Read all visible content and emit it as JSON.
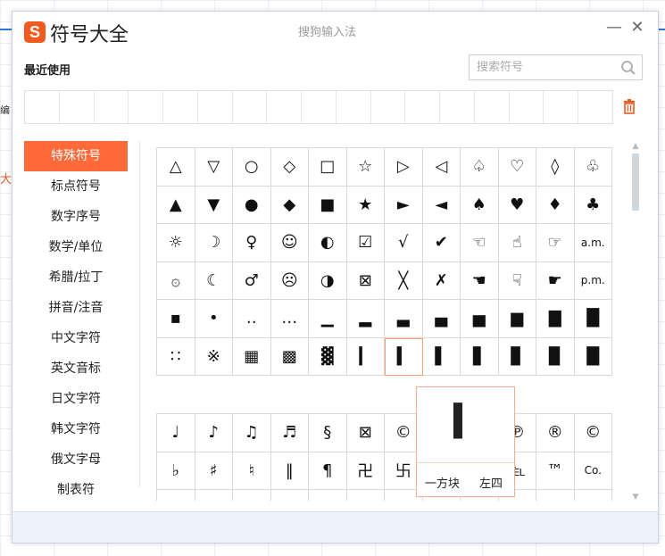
{
  "window": {
    "title": "符号大全",
    "subtitle": "搜狗输入法",
    "logo_letter": "S",
    "minimize_label": "—",
    "close_label": "✕"
  },
  "background": {
    "fragment_text": "编",
    "red_fragment": "大"
  },
  "recent": {
    "label": "最近使用",
    "cells": [
      "",
      "",
      "",
      "",
      "",
      "",
      "",
      "",
      "",
      "",
      "",
      "",
      "",
      "",
      "",
      "",
      ""
    ]
  },
  "search": {
    "placeholder": "搜索符号",
    "value": ""
  },
  "sidebar": {
    "items": [
      {
        "label": "特殊符号",
        "active": true
      },
      {
        "label": "标点符号"
      },
      {
        "label": "数字序号"
      },
      {
        "label": "数学/单位"
      },
      {
        "label": "希腊/拉丁"
      },
      {
        "label": "拼音/注音"
      },
      {
        "label": "中文字符"
      },
      {
        "label": "英文音标"
      },
      {
        "label": "日文字符"
      },
      {
        "label": "韩文字符"
      },
      {
        "label": "俄文字母"
      },
      {
        "label": "制表符"
      }
    ]
  },
  "grid_primary": [
    "△",
    "▽",
    "○",
    "◇",
    "□",
    "☆",
    "▷",
    "◁",
    "♤",
    "♡",
    "◊",
    "♧",
    "▲",
    "▼",
    "●",
    "◆",
    "■",
    "★",
    "►",
    "◄",
    "♠",
    "♥",
    "♦",
    "♣",
    "☼",
    "☽",
    "♀",
    "☺",
    "◐",
    "☑",
    "√",
    "✔",
    "☜",
    "☝",
    "☞",
    "a.m.",
    "۞",
    "☾",
    "♂",
    "☹",
    "◑",
    "⊠",
    "╳",
    "✗",
    "☚",
    "☟",
    "☛",
    "p.m.",
    "▪",
    "•",
    "‥",
    "…",
    "▁",
    "▂",
    "▃",
    "▄",
    "▅",
    "▆",
    "▇",
    "█",
    "∷",
    "※",
    "▦",
    "▩",
    "▓",
    "▎",
    "▍",
    "▌",
    "▋",
    "▊",
    "▉",
    "█"
  ],
  "grid_secondary": [
    "♩",
    "♪",
    "♫",
    "♬",
    "§",
    "⊠",
    "©",
    "",
    "",
    "℗",
    "®",
    "©",
    "♭",
    "♯",
    "♮",
    "‖",
    "¶",
    "卍",
    "卐",
    "",
    "",
    "℡",
    "™",
    "Co.",
    "",
    "",
    "",
    "",
    "",
    "",
    "",
    "",
    "",
    "",
    "",
    ""
  ],
  "preview": {
    "glyph": "▍",
    "name": "一方块",
    "tag": "左四"
  },
  "colors": {
    "accent": "#ff6a3a",
    "logo": "#f05a1f",
    "border": "#d9d9d9"
  }
}
